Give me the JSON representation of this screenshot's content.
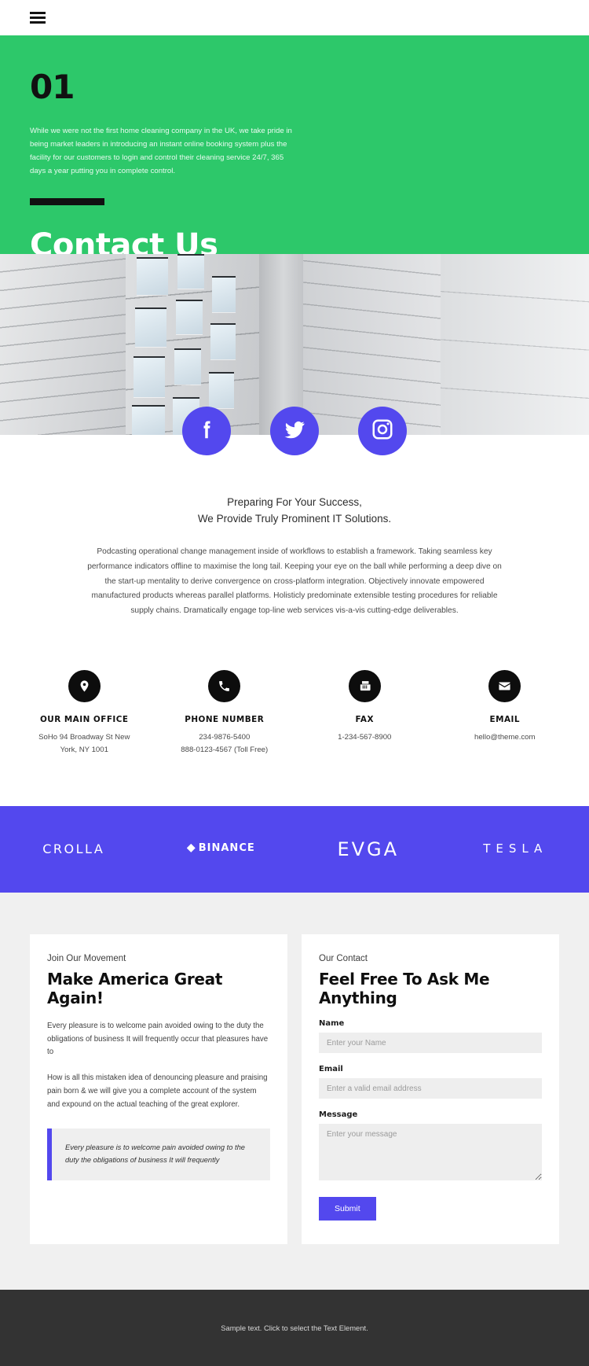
{
  "header": {
    "menu_icon": "hamburger-menu-icon"
  },
  "hero": {
    "number": "01",
    "paragraph": "While we were not the first home cleaning company in the UK, we take pride in being market leaders in introducing an instant online booking system plus the facility for our customers to login and control their cleaning service 24/7, 365 days a year putting you in complete control.",
    "title": "Contact Us",
    "background_color": "#2dc86a"
  },
  "socials": [
    {
      "name": "facebook",
      "label": "Facebook"
    },
    {
      "name": "twitter",
      "label": "Twitter"
    },
    {
      "name": "instagram",
      "label": "Instagram"
    }
  ],
  "intro": {
    "heading_line1": "Preparing For Your Success,",
    "heading_line2": "We Provide Truly Prominent IT Solutions.",
    "body": "Podcasting operational change management inside of workflows to establish a framework. Taking seamless key performance indicators offline to maximise the long tail. Keeping your eye on the ball while performing a deep dive on the start-up mentality to derive convergence on cross-platform integration. Objectively innovate empowered manufactured products whereas parallel platforms. Holisticly predominate extensible testing procedures for reliable supply chains. Dramatically engage top-line web services vis-a-vis cutting-edge deliverables."
  },
  "contacts": [
    {
      "icon": "location-pin-icon",
      "title": "OUR MAIN OFFICE",
      "line1": "SoHo 94 Broadway St New",
      "line2": "York, NY 1001"
    },
    {
      "icon": "phone-icon",
      "title": "PHONE NUMBER",
      "line1": "234-9876-5400",
      "line2": "888-0123-4567 (Toll Free)"
    },
    {
      "icon": "fax-icon",
      "title": "FAX",
      "line1": "1-234-567-8900",
      "line2": ""
    },
    {
      "icon": "email-envelope-icon",
      "title": "EMAIL",
      "line1": "hello@theme.com",
      "line2": ""
    }
  ],
  "brands": {
    "background_color": "#5348ee",
    "items": [
      {
        "name": "crolla",
        "label": "CROLLA"
      },
      {
        "name": "binance",
        "label": "BINANCE"
      },
      {
        "name": "evga",
        "label": "EVGA"
      },
      {
        "name": "tesla",
        "label": "TESLA"
      }
    ]
  },
  "left_card": {
    "eyebrow": "Join Our Movement",
    "title": "Make America Great Again!",
    "paragraph1": "Every pleasure is to welcome pain avoided owing to the duty the obligations of business It will frequently occur that pleasures have to",
    "paragraph2": "How is all this mistaken idea of denouncing pleasure and praising pain born & we will give you a complete account of the system and expound on the actual teaching of the great explorer.",
    "quote": "Every pleasure is to welcome pain avoided owing to the duty the obligations of business It will frequently",
    "quote_accent_color": "#5348ee"
  },
  "form_card": {
    "eyebrow": "Our Contact",
    "title": "Feel Free To Ask Me Anything",
    "fields": [
      {
        "label": "Name",
        "placeholder": "Enter your Name",
        "value": ""
      },
      {
        "label": "Email",
        "placeholder": "Enter a valid email address",
        "value": ""
      },
      {
        "label": "Message",
        "placeholder": "Enter your message",
        "value": ""
      }
    ],
    "submit_label": "Submit",
    "submit_color": "#5348ee"
  },
  "footer": {
    "text": "Sample text. Click to select the Text Element.",
    "background_color": "#333333"
  }
}
